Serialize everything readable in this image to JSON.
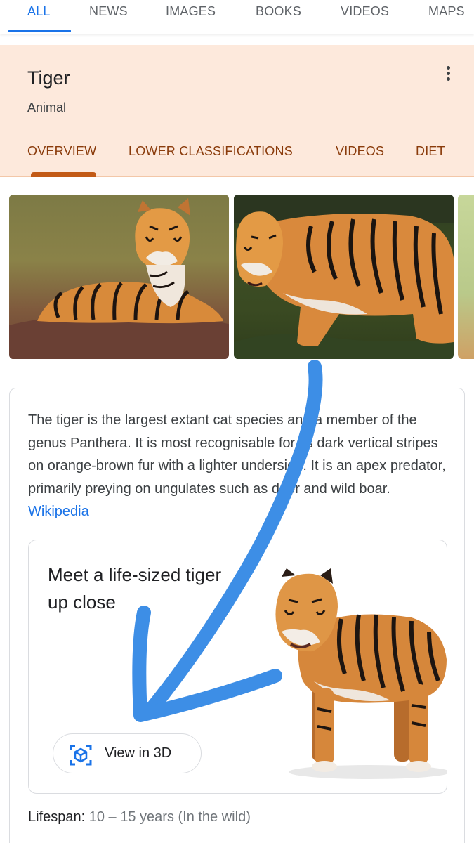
{
  "search_tabs": [
    {
      "label": "ALL",
      "active": true
    },
    {
      "label": "NEWS",
      "active": false
    },
    {
      "label": "IMAGES",
      "active": false
    },
    {
      "label": "BOOKS",
      "active": false
    },
    {
      "label": "VIDEOS",
      "active": false
    },
    {
      "label": "MAPS",
      "active": false
    }
  ],
  "knowledge_panel": {
    "title": "Tiger",
    "subtitle": "Animal",
    "more_icon": "more-vert-icon",
    "tabs": [
      {
        "label": "OVERVIEW",
        "active": true
      },
      {
        "label": "LOWER CLASSIFICATIONS",
        "active": false
      },
      {
        "label": "VIDEOS",
        "active": false
      },
      {
        "label": "DIET",
        "active": false
      }
    ],
    "accent_color": "#c25a16",
    "header_bg": "#fde9dc"
  },
  "description": {
    "text": "The tiger is the largest extant cat species and a member of the genus Panthera. It is most recognisable for its dark vertical stripes on orange-brown fur with a lighter underside. It is an apex predator, primarily preying on ungulates such as deer and wild boar.",
    "source_link": "Wikipedia"
  },
  "ar_card": {
    "title": "Meet a life-sized tiger up close",
    "button_label": "View in 3D",
    "button_icon": "view-in-3d-cube-icon"
  },
  "facts": {
    "lifespan_label": "Lifespan:",
    "lifespan_value": "10 – 15 years (In the wild)"
  },
  "colors": {
    "link_blue": "#1a73e8",
    "annotation_blue": "#3d8ee6"
  }
}
